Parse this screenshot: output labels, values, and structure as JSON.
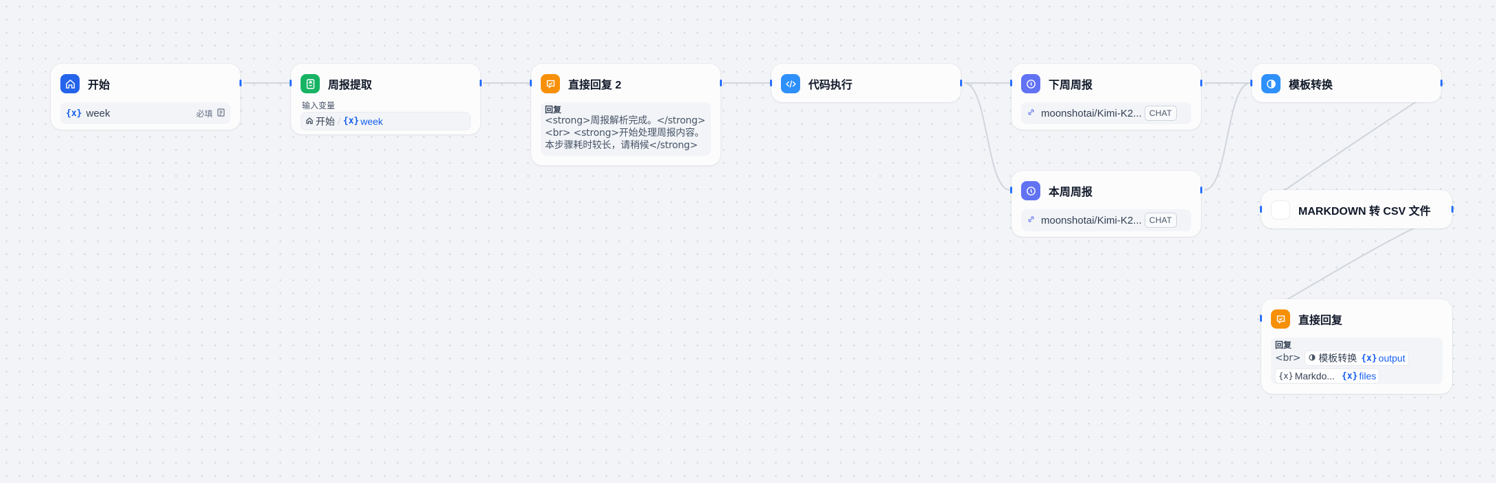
{
  "canvas": {
    "accent": "#2970ff",
    "edge_color": "#d0d5dd"
  },
  "nodes": {
    "start": {
      "title": "开始",
      "icon": "home-icon",
      "color": "#2563eb",
      "var_name": "week",
      "required": "必填"
    },
    "extract": {
      "title": "周报提取",
      "icon": "document-icon",
      "color": "#16b364",
      "input_label": "输入变量",
      "source_node": "开始",
      "source_var": "week"
    },
    "reply2": {
      "title": "直接回复 2",
      "icon": "reply-icon",
      "color": "#f79009",
      "reply_label": "回复",
      "lines": [
        "<strong>周报解析完成。</strong>",
        "<br> <strong>开始处理周报内容。",
        "本步骤耗时较长，请稍候</strong>"
      ]
    },
    "code": {
      "title": "代码执行",
      "icon": "code-icon",
      "color": "#2e90fa"
    },
    "next_week": {
      "title": "下周周报",
      "icon": "llm-icon",
      "color": "#6172f3",
      "model": "moonshotai/Kimi-K2...",
      "mode": "CHAT"
    },
    "this_week": {
      "title": "本周周报",
      "icon": "llm-icon",
      "color": "#6172f3",
      "model": "moonshotai/Kimi-K2...",
      "mode": "CHAT"
    },
    "template": {
      "title": "模板转换",
      "icon": "template-icon",
      "color": "#2e90fa"
    },
    "md_csv": {
      "title": "MARKDOWN 转 CSV 文件",
      "icon": "blank-icon"
    },
    "reply": {
      "title": "直接回复",
      "icon": "reply-icon",
      "color": "#f79009",
      "reply_label": "回复",
      "br": "<br>",
      "chip1_node": "模板转换",
      "chip1_var": "output",
      "chip2_node": "Markdo...",
      "chip2_var": "files"
    }
  }
}
